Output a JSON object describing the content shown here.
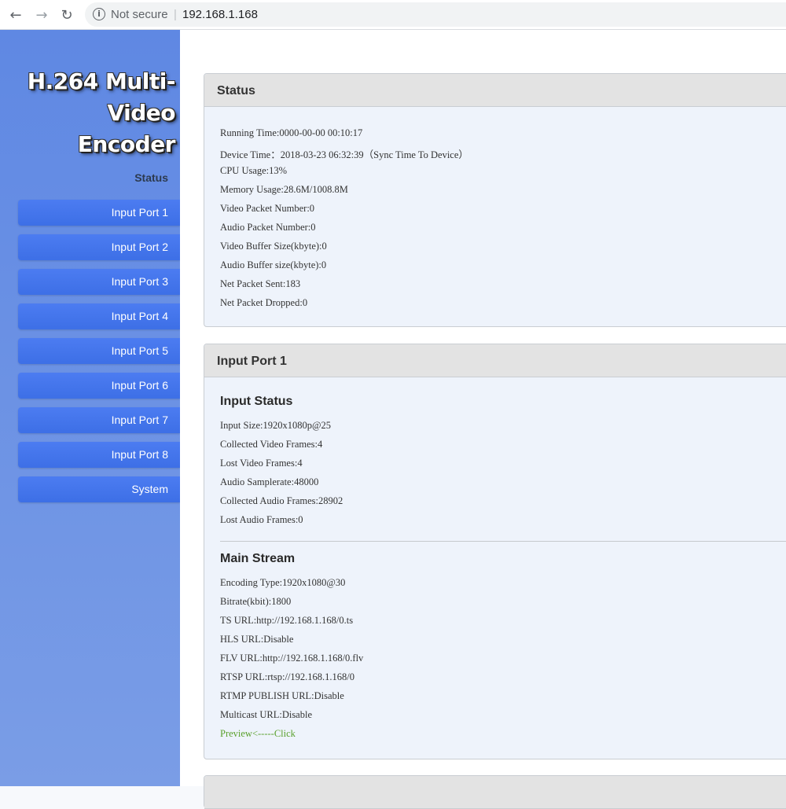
{
  "browser": {
    "not_secure": "Not secure",
    "separator": "|",
    "url": "192.168.1.168"
  },
  "sidebar": {
    "logo_line1": "H.264 Multi-",
    "logo_line2": "Video Encoder",
    "status_link": "Status",
    "items": [
      {
        "label": "Input Port 1"
      },
      {
        "label": "Input Port 2"
      },
      {
        "label": "Input Port 3"
      },
      {
        "label": "Input Port 4"
      },
      {
        "label": "Input Port 5"
      },
      {
        "label": "Input Port 6"
      },
      {
        "label": "Input Port 7"
      },
      {
        "label": "Input Port 8"
      },
      {
        "label": "System"
      }
    ]
  },
  "status_panel": {
    "title": "Status",
    "lines": [
      "Running Time:0000-00-00 00:10:17",
      "Device Time：2018-03-23 06:32:39（Sync Time To Device）",
      "CPU Usage:13%",
      "Memory Usage:28.6M/1008.8M",
      "Video Packet Number:0",
      "Audio Packet Number:0",
      "Video Buffer Size(kbyte):0",
      "Audio Buffer size(kbyte):0",
      "Net Packet Sent:183",
      "Net Packet Dropped:0"
    ]
  },
  "port_panel": {
    "title": "Input Port 1",
    "input_status_title": "Input Status",
    "input_status_lines": [
      "Input Size:1920x1080p@25",
      "Collected Video Frames:4",
      "Lost Video Frames:4",
      "Audio Samplerate:48000",
      "Collected Audio Frames:28902",
      "Lost Audio Frames:0"
    ],
    "main_stream_title": "Main Stream",
    "main_stream_lines": [
      "Encoding Type:1920x1080@30",
      "Bitrate(kbit):1800",
      "TS URL:http://192.168.1.168/0.ts",
      "HLS URL:Disable",
      "FLV URL:http://192.168.1.168/0.flv",
      "RTSP URL:rtsp://192.168.1.168/0",
      "RTMP PUBLISH URL:Disable",
      "Multicast URL:Disable"
    ],
    "preview_link": "Preview<-----Click"
  },
  "colors": {
    "sidebar": "#6a90e4",
    "menu_button": "#4477ee",
    "preview_link": "#5aa02c"
  }
}
